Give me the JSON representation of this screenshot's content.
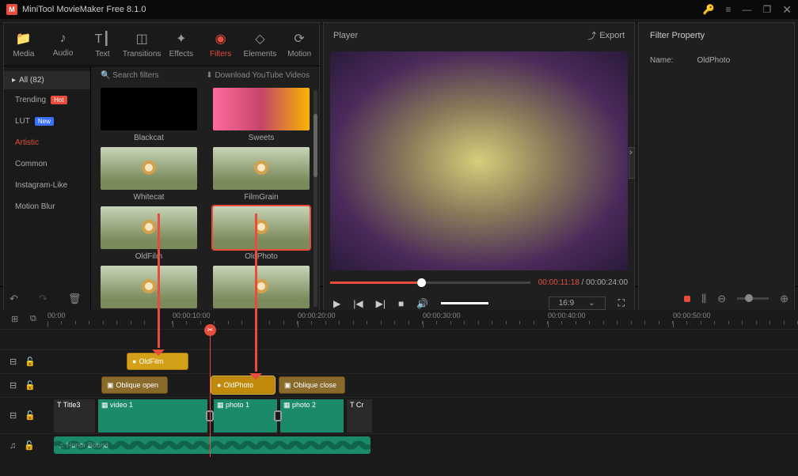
{
  "app": {
    "title": "MiniTool MovieMaker Free 8.1.0"
  },
  "tabs": [
    {
      "id": "media",
      "label": "Media"
    },
    {
      "id": "audio",
      "label": "Audio"
    },
    {
      "id": "text",
      "label": "Text"
    },
    {
      "id": "transitions",
      "label": "Transitions"
    },
    {
      "id": "effects",
      "label": "Effects"
    },
    {
      "id": "filters",
      "label": "Filters"
    },
    {
      "id": "elements",
      "label": "Elements"
    },
    {
      "id": "motion",
      "label": "Motion"
    }
  ],
  "active_tab": "filters",
  "categories": {
    "header": "All (82)",
    "items": [
      {
        "label": "Trending",
        "badge": "Hot",
        "cls": "hot"
      },
      {
        "label": "LUT",
        "badge": "New",
        "cls": "new"
      },
      {
        "label": "Artistic",
        "active": true
      },
      {
        "label": "Common"
      },
      {
        "label": "Instagram-Like"
      },
      {
        "label": "Motion Blur"
      }
    ]
  },
  "filter_top": {
    "search": "Search filters",
    "download": "Download YouTube Videos"
  },
  "thumbs": [
    {
      "label": "Blackcat",
      "cls": "blackcat"
    },
    {
      "label": "Sweets",
      "cls": "sweets"
    },
    {
      "label": "Whitecat"
    },
    {
      "label": "FilmGrain"
    },
    {
      "label": "OldFilm"
    },
    {
      "label": "OldPhoto",
      "sel": true
    },
    {
      "label": ""
    },
    {
      "label": ""
    }
  ],
  "player": {
    "title": "Player",
    "export": "Export",
    "time_cur": "00:00:11:18",
    "time_total": "00:00:24:00",
    "aspect": "16:9"
  },
  "property": {
    "title": "Filter Property",
    "name_lbl": "Name:",
    "name_val": "OldPhoto"
  },
  "ruler": [
    "00:00",
    "00:00:10:00",
    "00:00:20:00",
    "00:00:30:00",
    "00:00:40:00",
    "00:00:50:00"
  ],
  "clips": {
    "oldfilm": "OldFilm",
    "oldphoto": "OldPhoto",
    "oblique_open": "Oblique open",
    "oblique_close": "Oblique close",
    "title3": "Title3",
    "video1": "video 1",
    "photo1": "photo 1",
    "photo2": "photo 2",
    "cr": "Cr",
    "honor": "Honor Bound"
  }
}
